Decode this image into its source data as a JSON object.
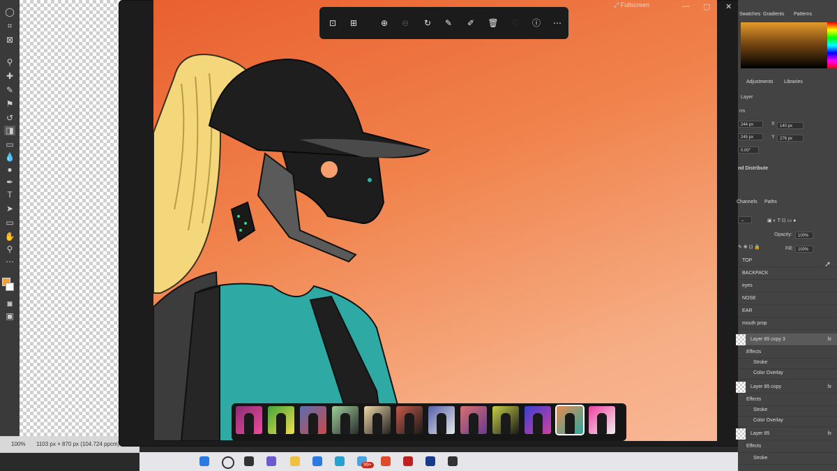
{
  "viewer": {
    "title": "Fullscreen",
    "toolbar_icons": [
      "view-icon",
      "crop-adjust-icon",
      "zoom-in-icon",
      "zoom-out-icon",
      "rotate-icon",
      "edit-icon",
      "draw-icon",
      "delete-icon",
      "favorite-icon",
      "info-icon",
      "more-icon"
    ],
    "window_controls": {
      "minimize": "—",
      "maximize": "▢",
      "close": "✕"
    }
  },
  "photoshop": {
    "status_bar": {
      "zoom": "100%",
      "dimensions": "1103 px × 870 px (104.724 ppcm)"
    },
    "colors": {
      "foreground": "#f2a23c",
      "background": "#ffffff"
    },
    "panel_tabs_top": [
      "Swatches",
      "Gradients",
      "Patterns"
    ],
    "panel_tabs_mid": [
      "Adjustments",
      "Libraries"
    ],
    "properties": {
      "section_label": "Layer",
      "transform_label": "rm",
      "w": "244 px",
      "x": "140 px",
      "h": "245 px",
      "y": "276 px",
      "angle": "0.00°",
      "align_label": "nd Distribute"
    },
    "layers_tabs": [
      "Channels",
      "Paths"
    ],
    "opacity_label": "Opacity:",
    "opacity": "100%",
    "fill_label": "Fill:",
    "fill": "100%",
    "layers": [
      {
        "name": "TOP"
      },
      {
        "name": "BACKPACK"
      },
      {
        "name": "eyes"
      },
      {
        "name": "NOSE"
      },
      {
        "name": "EAR"
      },
      {
        "name": "mouth prop"
      },
      {
        "name": "Layer 85 copy 3",
        "fx": "fx"
      },
      {
        "name": "Effects"
      },
      {
        "name": "Stroke"
      },
      {
        "name": "Color Overlay"
      },
      {
        "name": "Layer 85 copy",
        "fx": "fx"
      },
      {
        "name": "Effects"
      },
      {
        "name": "Stroke"
      },
      {
        "name": "Color Overlay"
      },
      {
        "name": "Layer 85",
        "fx": "fx"
      },
      {
        "name": "Effects"
      },
      {
        "name": "Stroke"
      }
    ]
  },
  "filmstrip": {
    "thumbnails": [
      {
        "bg": "#8a2d74",
        "accent": "#f04a9a"
      },
      {
        "bg": "#3fa33a",
        "accent": "#f5e04a"
      },
      {
        "bg": "#5a6fb0",
        "accent": "#c84a4a"
      },
      {
        "bg": "#9dcf9a",
        "accent": "#2c2c2c"
      },
      {
        "bg": "#efd8a8",
        "accent": "#222"
      },
      {
        "bg": "#c55a4a",
        "accent": "#1a1a1a"
      },
      {
        "bg": "#5560a8",
        "accent": "#e8e8e8"
      },
      {
        "bg": "#d67070",
        "accent": "#6a3a90"
      },
      {
        "bg": "#c8d048",
        "accent": "#1a1a1a"
      },
      {
        "bg": "#3b3fd0",
        "accent": "#d040a0"
      },
      {
        "bg": "#ea8a50",
        "accent": "#2aa8a0",
        "selected": true
      },
      {
        "bg": "#ee40a0",
        "accent": "#f0f0f0"
      }
    ]
  },
  "taskbar": {
    "badge": "99+"
  }
}
